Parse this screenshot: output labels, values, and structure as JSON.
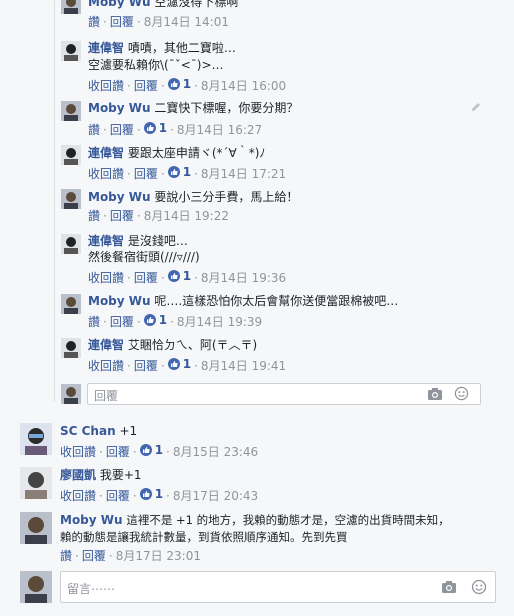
{
  "replies": [
    {
      "author": "Moby Wu",
      "text": "空濾沒得下標啊",
      "like": "讚",
      "reply": "回覆",
      "date": "8月14日 14:01"
    },
    {
      "author": "連偉智",
      "text": "嘖嘖，其他二寶啦…",
      "text2": "空濾要私賴你\\(¯ˇ<¯)>…",
      "like": "收回讚",
      "reply": "回覆",
      "likes": "1",
      "date": "8月14日 16:00"
    },
    {
      "author": "Moby Wu",
      "text": "二寶快下標喔，你要分期？",
      "like": "讚",
      "reply": "回覆",
      "likes": "1",
      "date": "8月14日 16:27"
    },
    {
      "author": "連偉智",
      "text": "要跟太座申請ヾ(*´∀｀*)ﾉ",
      "like": "收回讚",
      "reply": "回覆",
      "likes": "1",
      "date": "8月14日 17:21"
    },
    {
      "author": "Moby Wu",
      "text": "要說小三分手費，馬上給！",
      "like": "讚",
      "reply": "回覆",
      "date": "8月14日 19:22"
    },
    {
      "author": "連偉智",
      "text": "是沒錢吧…",
      "text2": "然後餐宿街頭(///▿///)",
      "like": "收回讚",
      "reply": "回覆",
      "likes": "1",
      "date": "8月14日 19:36"
    },
    {
      "author": "Moby Wu",
      "text": "呢….這樣恐怕你太后會幫你送便當跟棉被吧…",
      "like": "讚",
      "reply": "回覆",
      "likes": "1",
      "date": "8月14日 19:39"
    },
    {
      "author": "連偉智",
      "text": "艾睏恰ㄉㄟ、阿(〒︿〒)",
      "like": "收回讚",
      "reply": "回覆",
      "likes": "1",
      "date": "8月14日 19:41"
    }
  ],
  "reply_input": {
    "placeholder": "回覆"
  },
  "comments": [
    {
      "author": "SC Chan",
      "text": "+1",
      "like": "收回讚",
      "reply": "回覆",
      "likes": "1",
      "date": "8月15日 23:46"
    },
    {
      "author": "廖國凱",
      "text": "我要+1",
      "like": "收回讚",
      "reply": "回覆",
      "likes": "1",
      "date": "8月17日 20:43"
    },
    {
      "author": "Moby Wu",
      "text": "這裡不是 +1 的地方，我賴的動態才是，空濾的出貨時間未知，",
      "text2": "賴的動態是讓我統計數量，到貨依照順序通知。先到先買",
      "like": "讚",
      "reply": "回覆",
      "date": "8月17日 23:01"
    }
  ],
  "comment_input": {
    "placeholder": "留言⋯⋯"
  },
  "colors": {
    "link": "#365899",
    "meta": "#90949c",
    "like_badge": "#4267b2",
    "background": "#f6f7f9"
  },
  "icons": [
    "camera-icon",
    "emoji-icon",
    "thumbs-up-icon",
    "pencil-icon"
  ]
}
